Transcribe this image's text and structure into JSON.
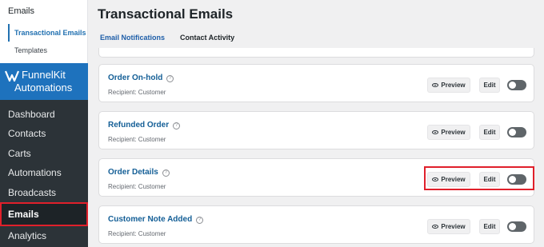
{
  "submenu": {
    "title": "Emails",
    "items": [
      {
        "label": "Transactional Emails",
        "active": true
      },
      {
        "label": "Templates",
        "active": false
      }
    ]
  },
  "brand": {
    "line1": "FunnelKit",
    "line2": "Automations",
    "color": "#1e72bd"
  },
  "menu": {
    "items": [
      {
        "label": "Dashboard"
      },
      {
        "label": "Contacts"
      },
      {
        "label": "Carts"
      },
      {
        "label": "Automations"
      },
      {
        "label": "Broadcasts"
      },
      {
        "label": "Emails",
        "active": true
      },
      {
        "label": "Analytics"
      }
    ]
  },
  "page": {
    "title": "Transactional Emails",
    "tabs": [
      {
        "label": "Email Notifications",
        "active": true
      },
      {
        "label": "Contact Activity",
        "active": false
      }
    ]
  },
  "emails": [
    {
      "name": "Order On-hold",
      "recipient": "Recipient: Customer",
      "preview_label": "Preview",
      "edit_label": "Edit",
      "enabled": false
    },
    {
      "name": "Refunded Order",
      "recipient": "Recipient: Customer",
      "preview_label": "Preview",
      "edit_label": "Edit",
      "enabled": false
    },
    {
      "name": "Order Details",
      "recipient": "Recipient: Customer",
      "preview_label": "Preview",
      "edit_label": "Edit",
      "enabled": false,
      "highlighted": true
    },
    {
      "name": "Customer Note Added",
      "recipient": "Recipient: Customer",
      "preview_label": "Preview",
      "edit_label": "Edit",
      "enabled": false
    }
  ],
  "icons": {
    "info": "info-icon",
    "preview": "eye-icon",
    "logo": "funnelkit-logo"
  },
  "colors": {
    "accent": "#2271b1",
    "highlight": "#e0202b",
    "sidebar": "#2c3338"
  }
}
